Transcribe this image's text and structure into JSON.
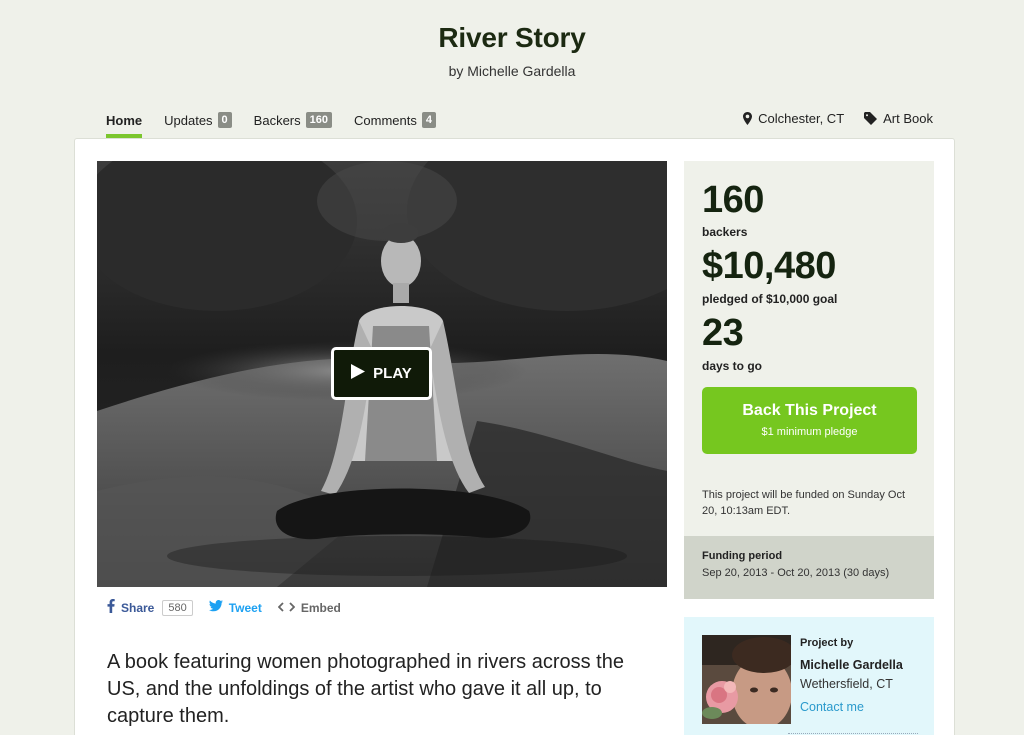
{
  "header": {
    "title": "River Story",
    "byline": "by Michelle Gardella"
  },
  "nav": {
    "home": "Home",
    "updates": "Updates",
    "updates_count": "0",
    "backers": "Backers",
    "backers_count": "160",
    "comments": "Comments",
    "comments_count": "4"
  },
  "meta": {
    "location": "Colchester, CT",
    "category": "Art Book"
  },
  "video": {
    "play_label": "PLAY"
  },
  "share": {
    "share_label": "Share",
    "share_count": "580",
    "tweet_label": "Tweet",
    "embed_label": "Embed"
  },
  "blurb": "A book featuring women photographed in rivers across the US, and the unfoldings of the artist who gave it all up, to capture them.",
  "stats": {
    "backers_num": "160",
    "backers_label": "backers",
    "pledged_num": "$10,480",
    "pledged_label": "pledged of $10,000 goal",
    "days_num": "23",
    "days_label": "days to go"
  },
  "cta": {
    "label": "Back This Project",
    "sub": "$1 minimum pledge"
  },
  "funding_note": "This project will be funded on Sunday Oct 20, 10:13am EDT.",
  "period": {
    "label": "Funding period",
    "value": "Sep 20, 2013 - Oct 20, 2013 (30 days)"
  },
  "creator": {
    "by_label": "Project by",
    "name": "Michelle Gardella",
    "location": "Wethersfield, CT",
    "contact": "Contact me"
  },
  "colors": {
    "accent_green": "#76c71f",
    "creator_bg": "#e2f7fb",
    "facebook_blue": "#3b5998",
    "twitter_blue": "#1da1f2"
  },
  "icons": [
    "map-pin-icon",
    "tag-icon",
    "play-icon",
    "facebook-icon",
    "twitter-icon",
    "embed-icon"
  ]
}
